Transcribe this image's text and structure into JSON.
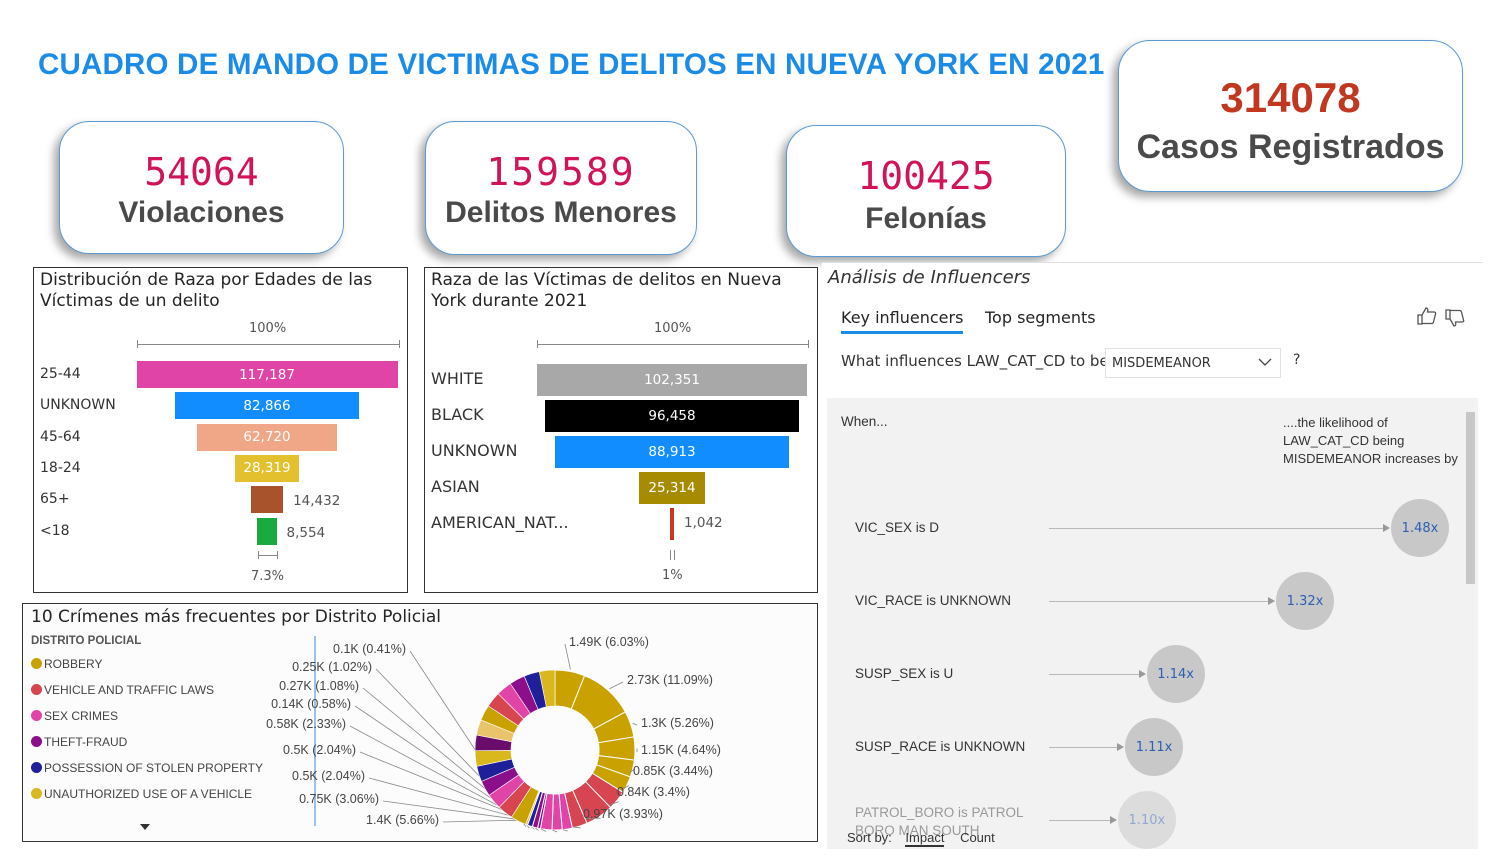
{
  "title": "CUADRO DE MANDO DE VICTIMAS DE DELITOS EN NUEVA YORK EN 2021",
  "kpis": {
    "violaciones": {
      "value": "54064",
      "label": "Violaciones"
    },
    "menores": {
      "value": "159589",
      "label": "Delitos Menores"
    },
    "felonias": {
      "value": "100425",
      "label": "Felonías"
    },
    "casos": {
      "value": "314078",
      "label": "Casos Registrados"
    }
  },
  "chart_data": [
    {
      "type": "bar",
      "subtype": "funnel",
      "title": "Distribución de Raza por Edades de las Víctimas de un delito",
      "top_pct": "100%",
      "bottom_pct": "7.3%",
      "categories": [
        "25-44",
        "UNKNOWN",
        "45-64",
        "18-24",
        "65+",
        "<18"
      ],
      "values": [
        117187,
        82866,
        62720,
        28319,
        14432,
        8554
      ],
      "labels": [
        "117,187",
        "82,866",
        "62,720",
        "28,319",
        "14,432",
        "8,554"
      ],
      "colors": [
        "#e044a7",
        "#118dff",
        "#f0a787",
        "#e2c02e",
        "#a9532d",
        "#1aab40"
      ]
    },
    {
      "type": "bar",
      "subtype": "funnel",
      "title": "Raza de las Víctimas de delitos en Nueva York durante 2021",
      "top_pct": "100%",
      "bottom_pct": "1%",
      "categories": [
        "WHITE",
        "BLACK",
        "UNKNOWN",
        "ASIAN",
        "AMERICAN_NAT..."
      ],
      "values": [
        102351,
        96458,
        88913,
        25314,
        1042
      ],
      "labels": [
        "102,351",
        "96,458",
        "88,913",
        "25,314",
        "1,042"
      ],
      "colors": [
        "#a8a8a8",
        "#000000",
        "#118dff",
        "#a68a00",
        "#c8382a"
      ]
    },
    {
      "type": "pie",
      "subtype": "donut",
      "title": "10 Crímenes más frecuentes por Distrito Policial",
      "legend_title": "DISTRITO POLICIAL",
      "legend": [
        {
          "name": "ROBBERY",
          "color": "#c9a200"
        },
        {
          "name": "VEHICLE AND TRAFFIC LAWS",
          "color": "#d64550"
        },
        {
          "name": "SEX CRIMES",
          "color": "#e044a7"
        },
        {
          "name": "THEFT-FRAUD",
          "color": "#8b0f8b"
        },
        {
          "name": "POSSESSION OF STOLEN PROPERTY",
          "color": "#1f1f9a"
        },
        {
          "name": "UNAUTHORIZED USE OF A VEHICLE",
          "color": "#d9b81e"
        }
      ],
      "slices": [
        {
          "label": "1.49K (6.03%)",
          "value": 1490,
          "pct": 6.03,
          "color": "#c9a200"
        },
        {
          "label": "2.73K (11.09%)",
          "value": 2730,
          "pct": 11.09,
          "color": "#c9a200"
        },
        {
          "label": "1.3K (5.26%)",
          "value": 1300,
          "pct": 5.26,
          "color": "#c9a200"
        },
        {
          "label": "1.15K (4.64%)",
          "value": 1150,
          "pct": 4.64,
          "color": "#c9a200"
        },
        {
          "label": "0.85K (3.44%)",
          "value": 850,
          "pct": 3.44,
          "color": "#c9a200"
        },
        {
          "label": "0.84K (3.4%)",
          "value": 840,
          "pct": 3.4,
          "color": "#c9a200"
        },
        {
          "label": "0.97K (3.93%)",
          "value": 970,
          "pct": 3.93,
          "color": "#d64550"
        },
        {
          "label": "1.4K (5.66%)",
          "value": 1400,
          "pct": 5.66,
          "color": "#d64550"
        },
        {
          "label": "0.75K (3.06%)",
          "value": 750,
          "pct": 3.06,
          "color": "#d64550"
        },
        {
          "label": "0.5K (2.04%)",
          "value": 500,
          "pct": 2.04,
          "color": "#e044a7"
        },
        {
          "label": "0.5K (2.04%)",
          "value": 500,
          "pct": 2.04,
          "color": "#e044a7"
        },
        {
          "label": "0.58K (2.33%)",
          "value": 580,
          "pct": 2.33,
          "color": "#e044a7"
        },
        {
          "label": "0.14K (0.58%)",
          "value": 140,
          "pct": 0.58,
          "color": "#8b0f8b"
        },
        {
          "label": "0.27K (1.08%)",
          "value": 270,
          "pct": 1.08,
          "color": "#8b0f8b"
        },
        {
          "label": "0.25K (1.02%)",
          "value": 250,
          "pct": 1.02,
          "color": "#1f1f9a"
        },
        {
          "label": "0.1K (0.41%)",
          "value": 100,
          "pct": 0.41,
          "color": "#d9b81e"
        }
      ]
    }
  ],
  "influencers": {
    "title": "Análisis de Influencers",
    "tab_key": "Key influencers",
    "tab_top": "Top segments",
    "question": "What influences LAW_CAT_CD to be",
    "dropdown_value": "MISDEMEANOR",
    "question_mark": "?",
    "col_when": "When...",
    "col_likelihood": "....the likelihood of LAW_CAT_CD being MISDEMEANOR increases by",
    "rows": [
      {
        "label": "VIC_SEX is D",
        "value": "1.48x",
        "factor": 1.48
      },
      {
        "label": "VIC_RACE is UNKNOWN",
        "value": "1.32x",
        "factor": 1.32
      },
      {
        "label": "SUSP_SEX is U",
        "value": "1.14x",
        "factor": 1.14
      },
      {
        "label": "SUSP_RACE is UNKNOWN",
        "value": "1.11x",
        "factor": 1.11
      },
      {
        "label": "PATROL_BORO is PATROL BORO MAN SOUTH",
        "value": "1.10x",
        "factor": 1.1
      }
    ],
    "sort_label": "Sort by:",
    "sort_impact": "Impact",
    "sort_count": "Count"
  }
}
